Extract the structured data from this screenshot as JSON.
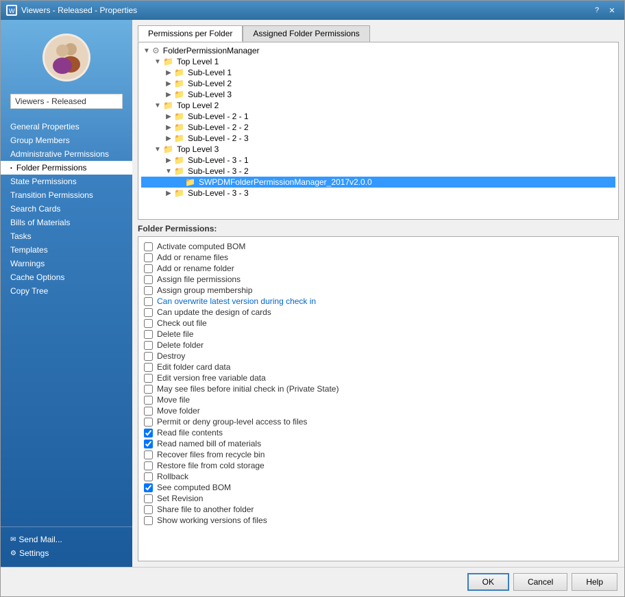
{
  "window": {
    "title": "Viewers - Released - Properties",
    "help_btn": "?",
    "close_btn": "✕"
  },
  "sidebar": {
    "group_label": "Viewers - Released",
    "nav_items": [
      {
        "id": "general-properties",
        "label": "General Properties",
        "active": false,
        "bullet": false
      },
      {
        "id": "group-members",
        "label": "Group Members",
        "active": false,
        "bullet": false
      },
      {
        "id": "administrative-permissions",
        "label": "Administrative Permissions",
        "active": false,
        "bullet": false
      },
      {
        "id": "folder-permissions",
        "label": "Folder Permissions",
        "active": true,
        "bullet": true
      },
      {
        "id": "state-permissions",
        "label": "State Permissions",
        "active": false,
        "bullet": false
      },
      {
        "id": "transition-permissions",
        "label": "Transition Permissions",
        "active": false,
        "bullet": false
      },
      {
        "id": "search-cards",
        "label": "Search Cards",
        "active": false,
        "bullet": false
      },
      {
        "id": "bills-of-materials",
        "label": "Bills of Materials",
        "active": false,
        "bullet": false
      },
      {
        "id": "tasks",
        "label": "Tasks",
        "active": false,
        "bullet": false
      },
      {
        "id": "templates",
        "label": "Templates",
        "active": false,
        "bullet": false
      },
      {
        "id": "warnings",
        "label": "Warnings",
        "active": false,
        "bullet": false
      },
      {
        "id": "cache-options",
        "label": "Cache Options",
        "active": false,
        "bullet": false
      },
      {
        "id": "copy-tree",
        "label": "Copy Tree",
        "active": false,
        "bullet": false
      }
    ],
    "footer_items": [
      {
        "id": "send-mail",
        "label": "Send Mail...",
        "icon": "✉"
      },
      {
        "id": "settings",
        "label": "Settings",
        "icon": "⚙"
      }
    ]
  },
  "tabs": [
    {
      "id": "permissions-per-folder",
      "label": "Permissions per Folder",
      "active": true
    },
    {
      "id": "assigned-folder-permissions",
      "label": "Assigned Folder Permissions",
      "active": false
    }
  ],
  "tree": {
    "nodes": [
      {
        "id": "root",
        "label": "FolderPermissionManager",
        "indent": 0,
        "expanded": true,
        "type": "gear",
        "expandable": true
      },
      {
        "id": "top1",
        "label": "Top Level 1",
        "indent": 1,
        "expanded": true,
        "type": "folder",
        "expandable": true
      },
      {
        "id": "sub1-1",
        "label": "Sub-Level 1",
        "indent": 2,
        "expanded": false,
        "type": "folder",
        "expandable": true
      },
      {
        "id": "sub1-2",
        "label": "Sub-Level 2",
        "indent": 2,
        "expanded": false,
        "type": "folder",
        "expandable": true
      },
      {
        "id": "sub1-3",
        "label": "Sub-Level 3",
        "indent": 2,
        "expanded": false,
        "type": "folder",
        "expandable": true
      },
      {
        "id": "top2",
        "label": "Top Level 2",
        "indent": 1,
        "expanded": true,
        "type": "folder",
        "expandable": true
      },
      {
        "id": "sub2-1",
        "label": "Sub-Level - 2 - 1",
        "indent": 2,
        "expanded": false,
        "type": "folder",
        "expandable": true
      },
      {
        "id": "sub2-2",
        "label": "Sub-Level - 2 - 2",
        "indent": 2,
        "expanded": false,
        "type": "folder",
        "expandable": true
      },
      {
        "id": "sub2-3",
        "label": "Sub-Level - 2 - 3",
        "indent": 2,
        "expanded": false,
        "type": "folder",
        "expandable": true
      },
      {
        "id": "top3",
        "label": "Top Level 3",
        "indent": 1,
        "expanded": true,
        "type": "folder",
        "expandable": true
      },
      {
        "id": "sub3-1",
        "label": "Sub-Level - 3 - 1",
        "indent": 2,
        "expanded": false,
        "type": "folder",
        "expandable": true
      },
      {
        "id": "sub3-2",
        "label": "Sub-Level - 3 - 2",
        "indent": 2,
        "expanded": true,
        "type": "folder",
        "expandable": true
      },
      {
        "id": "sub3-2-child",
        "label": "SWPDMFolderPermissionManager_2017v2.0.0",
        "indent": 3,
        "expanded": false,
        "type": "folder",
        "expandable": false,
        "selected": true
      },
      {
        "id": "sub3-3",
        "label": "Sub-Level - 3 - 3",
        "indent": 2,
        "expanded": false,
        "type": "folder",
        "expandable": true
      }
    ]
  },
  "permissions": {
    "section_label": "Folder Permissions:",
    "items": [
      {
        "id": "activate-bom",
        "label": "Activate computed BOM",
        "checked": false,
        "blue": false
      },
      {
        "id": "add-rename-file",
        "label": "Add or rename files",
        "checked": false,
        "blue": false
      },
      {
        "id": "add-rename-folder",
        "label": "Add or rename folder",
        "checked": false,
        "blue": false
      },
      {
        "id": "assign-file-perms",
        "label": "Assign file permissions",
        "checked": false,
        "blue": false
      },
      {
        "id": "assign-group",
        "label": "Assign group membership",
        "checked": false,
        "blue": false
      },
      {
        "id": "overwrite-version",
        "label": "Can overwrite latest version during check in",
        "checked": false,
        "blue": true
      },
      {
        "id": "update-cards",
        "label": "Can update the design of cards",
        "checked": false,
        "blue": false
      },
      {
        "id": "check-out",
        "label": "Check out file",
        "checked": false,
        "blue": false
      },
      {
        "id": "delete-file",
        "label": "Delete file",
        "checked": false,
        "blue": false
      },
      {
        "id": "delete-folder",
        "label": "Delete folder",
        "checked": false,
        "blue": false
      },
      {
        "id": "destroy",
        "label": "Destroy",
        "checked": false,
        "blue": false
      },
      {
        "id": "edit-folder-card",
        "label": "Edit folder card data",
        "checked": false,
        "blue": false
      },
      {
        "id": "edit-version-free",
        "label": "Edit version free variable data",
        "checked": false,
        "blue": false
      },
      {
        "id": "see-files-before",
        "label": "May see files before initial check in (Private State)",
        "checked": false,
        "blue": false
      },
      {
        "id": "move-file",
        "label": "Move file",
        "checked": false,
        "blue": false
      },
      {
        "id": "move-folder",
        "label": "Move folder",
        "checked": false,
        "blue": false
      },
      {
        "id": "permit-deny-group",
        "label": "Permit or deny group-level access to files",
        "checked": false,
        "blue": false
      },
      {
        "id": "read-contents",
        "label": "Read file contents",
        "checked": true,
        "blue": false
      },
      {
        "id": "read-named-bom",
        "label": "Read named bill of materials",
        "checked": true,
        "blue": false
      },
      {
        "id": "recover-recycle",
        "label": "Recover files from recycle bin",
        "checked": false,
        "blue": false
      },
      {
        "id": "restore-cold",
        "label": "Restore file from cold storage",
        "checked": false,
        "blue": false
      },
      {
        "id": "rollback",
        "label": "Rollback",
        "checked": false,
        "blue": false
      },
      {
        "id": "see-computed-bom",
        "label": "See computed BOM",
        "checked": true,
        "blue": false
      },
      {
        "id": "set-revision",
        "label": "Set Revision",
        "checked": false,
        "blue": false
      },
      {
        "id": "share-file",
        "label": "Share file to another folder",
        "checked": false,
        "blue": false
      },
      {
        "id": "show-working",
        "label": "Show working versions of files",
        "checked": false,
        "blue": false
      }
    ]
  },
  "footer_buttons": {
    "ok": "OK",
    "cancel": "Cancel",
    "help": "Help"
  }
}
